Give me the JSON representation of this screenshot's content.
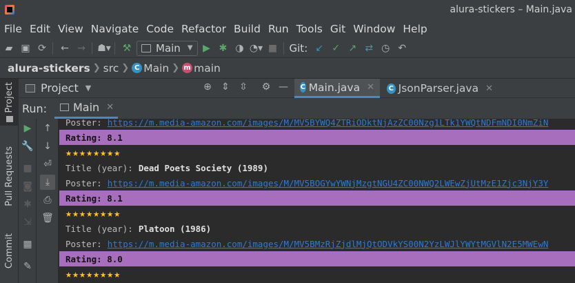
{
  "window": {
    "title": "alura-stickers – Main.java"
  },
  "menu": [
    "File",
    "Edit",
    "View",
    "Navigate",
    "Code",
    "Refactor",
    "Build",
    "Run",
    "Tools",
    "Git",
    "Window",
    "Help"
  ],
  "toolbar": {
    "run_config": "Main",
    "git_label": "Git:"
  },
  "breadcrumb": {
    "project": "alura-stickers",
    "folder": "src",
    "class": "Main",
    "method": "main"
  },
  "side_tabs": {
    "project": "Project",
    "pull_requests": "Pull Requests",
    "commit": "Commit"
  },
  "project_panel": {
    "label": "Project"
  },
  "editor_tabs": [
    {
      "label": "Main.java",
      "active": true
    },
    {
      "label": "JsonParser.java",
      "active": false
    }
  ],
  "run_panel": {
    "label": "Run:",
    "tab_label": "Main"
  },
  "console": {
    "lines": [
      {
        "kind": "poster",
        "label": "Poster:",
        "value": "https://m.media-amazon.com/images/M/MV5BYWQ4ZTRiODktNjAzZC00Nzg1LTk1YWQtNDFmNDI0NmZiN"
      },
      {
        "kind": "rating",
        "text": "Rating: 8.1"
      },
      {
        "kind": "stars",
        "text": "★★★★★★★★"
      },
      {
        "kind": "title",
        "label": "Title (year):",
        "value": "Dead Poets Society (1989)"
      },
      {
        "kind": "poster",
        "label": "Poster:",
        "value": "https://m.media-amazon.com/images/M/MV5BOGYwYWNjMzgtNGU4ZC00NWQ2LWEwZjUtMzE1Zjc3NjY3Y"
      },
      {
        "kind": "rating",
        "text": "Rating: 8.1"
      },
      {
        "kind": "stars",
        "text": "★★★★★★★★"
      },
      {
        "kind": "title",
        "label": "Title (year):",
        "value": "Platoon (1986)"
      },
      {
        "kind": "poster",
        "label": "Poster:",
        "value": "https://m.media-amazon.com/images/M/MV5BMzRjZjdlMjQtODVkYS00N2YzLWJlYWYtMGVlN2E5MWEwN"
      },
      {
        "kind": "rating",
        "text": "Rating: 8.0"
      },
      {
        "kind": "stars",
        "text": "★★★★★★★★"
      }
    ]
  },
  "colors": {
    "accent": "#4a88c7",
    "rating_bg": "#a66ebd",
    "link": "#287bde",
    "star": "#ffc50f"
  }
}
